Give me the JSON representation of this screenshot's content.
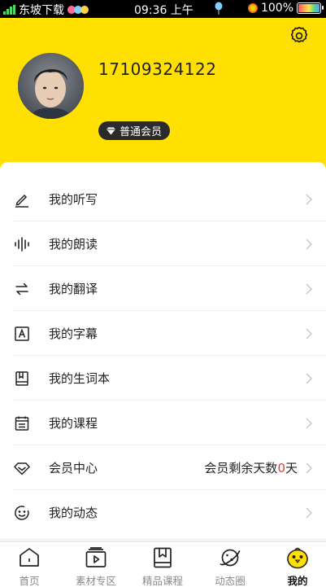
{
  "status_bar": {
    "carrier": "东坡下载",
    "time": "09:36 上午",
    "battery": "100%",
    "battery_level": 1.0
  },
  "profile": {
    "phone": "17109324122",
    "membership_badge": "普通会员"
  },
  "menu": {
    "items": [
      {
        "label": "我的听写",
        "icon": "pencil-icon"
      },
      {
        "label": "我的朗读",
        "icon": "soundwave-icon"
      },
      {
        "label": "我的翻译",
        "icon": "swap-arrows-icon"
      },
      {
        "label": "我的字幕",
        "icon": "subtitle-a-icon"
      },
      {
        "label": "我的生词本",
        "icon": "notebook-icon"
      },
      {
        "label": "我的课程",
        "icon": "calendar-icon"
      },
      {
        "label": "会员中心",
        "icon": "diamond-icon"
      },
      {
        "label": "我的动态",
        "icon": "smile-icon"
      }
    ],
    "vip": {
      "remaining_prefix": "会员剩余天数",
      "remaining_days": "0",
      "remaining_suffix": "天"
    }
  },
  "tabbar": {
    "tabs": [
      {
        "label": "首页",
        "icon": "home-icon"
      },
      {
        "label": "素材专区",
        "icon": "material-icon"
      },
      {
        "label": "精品课程",
        "icon": "bookmark-book-icon"
      },
      {
        "label": "动态圈",
        "icon": "planet-icon"
      },
      {
        "label": "我的",
        "icon": "chick-icon"
      }
    ],
    "active": "我的"
  },
  "colors": {
    "brand_yellow": "#ffe000",
    "highlight_red": "#e53935"
  }
}
